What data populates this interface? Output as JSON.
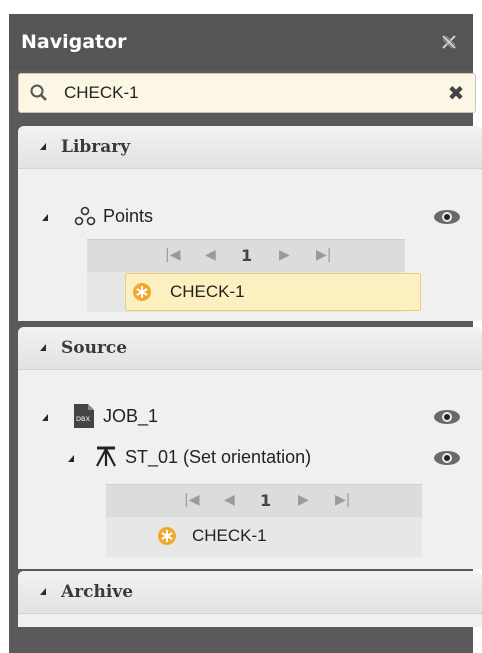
{
  "navigator": {
    "title": "Navigator",
    "search_value": "CHECK-1"
  },
  "library": {
    "header": "Library",
    "points_label": "Points",
    "pager_page": "1",
    "result_label": "CHECK-1"
  },
  "source": {
    "header": "Source",
    "job_label": "JOB_1",
    "job_icon_text": "DBX",
    "station_label": "ST_01 (Set orientation)",
    "pager_page": "1",
    "result_label": "CHECK-1"
  },
  "archive": {
    "header": "Archive"
  },
  "colors": {
    "titlebar": "#555555",
    "search_bg": "#fbf7e4",
    "selected_bg": "#fdf0c0",
    "point_icon": "#f0a830"
  }
}
